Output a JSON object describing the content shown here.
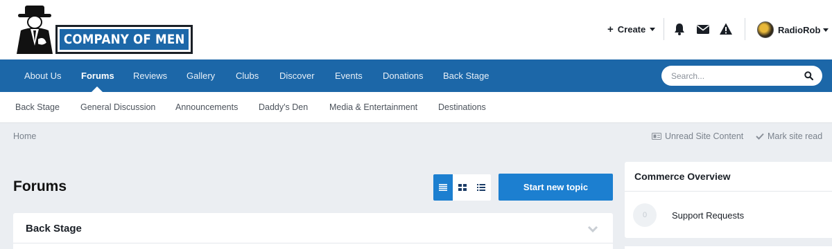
{
  "header": {
    "logo_text": "COMPANY OF MEN",
    "create_label": "Create",
    "username": "RadioRob"
  },
  "nav": {
    "items": [
      {
        "label": "About Us",
        "active": false
      },
      {
        "label": "Forums",
        "active": true
      },
      {
        "label": "Reviews",
        "active": false
      },
      {
        "label": "Gallery",
        "active": false
      },
      {
        "label": "Clubs",
        "active": false
      },
      {
        "label": "Discover",
        "active": false
      },
      {
        "label": "Events",
        "active": false
      },
      {
        "label": "Donations",
        "active": false
      },
      {
        "label": "Back Stage",
        "active": false
      }
    ],
    "search_placeholder": "Search..."
  },
  "subnav": {
    "items": [
      {
        "label": "Back Stage"
      },
      {
        "label": "General Discussion"
      },
      {
        "label": "Announcements"
      },
      {
        "label": "Daddy's Den"
      },
      {
        "label": "Media & Entertainment"
      },
      {
        "label": "Destinations"
      }
    ]
  },
  "breadcrumb": {
    "home": "Home",
    "unread_label": "Unread Site Content",
    "mark_read_label": "Mark site read"
  },
  "main": {
    "title": "Forums",
    "start_topic_label": "Start new topic",
    "category_title": "Back Stage"
  },
  "sidebar": {
    "widget_title": "Commerce Overview",
    "support_count": "0",
    "support_label": "Support Requests"
  },
  "colors": {
    "brand_blue": "#1c67a8",
    "button_blue": "#1c7fd0",
    "page_bg": "#ebeef2"
  },
  "icons": [
    "plus-icon",
    "bell-icon",
    "envelope-icon",
    "warning-icon",
    "search-icon",
    "unread-icon",
    "checkmark-icon",
    "table-view-icon",
    "grid-view-icon",
    "list-view-icon",
    "chevron-down-icon"
  ]
}
